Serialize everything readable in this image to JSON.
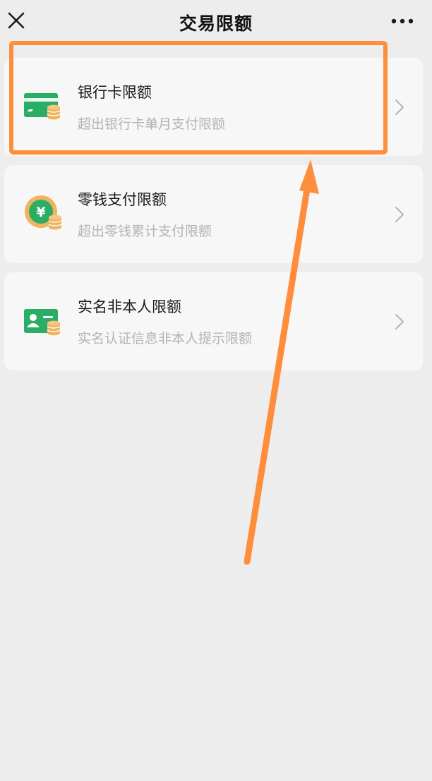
{
  "nav": {
    "title": "交易限额",
    "close_icon": "close-icon",
    "more_icon": "more-icon"
  },
  "items": [
    {
      "title": "银行卡限额",
      "subtitle": "超出银行卡单月支付限额",
      "icon": "bank-card-coins-icon"
    },
    {
      "title": "零钱支付限额",
      "subtitle": "超出零钱累计支付限额",
      "icon": "yuan-coin-icon"
    },
    {
      "title": "实名非本人限额",
      "subtitle": "实名认证信息非本人提示限额",
      "icon": "id-card-coins-icon"
    }
  ],
  "colors": {
    "background": "#EDEDED",
    "card": "#F7F7F7",
    "green": "#2AAE67",
    "coin": "#F0B35E",
    "annotation_orange": "#FF8E3C",
    "title_text": "#1A1A1A",
    "subtitle_text": "#B3B3B3"
  }
}
